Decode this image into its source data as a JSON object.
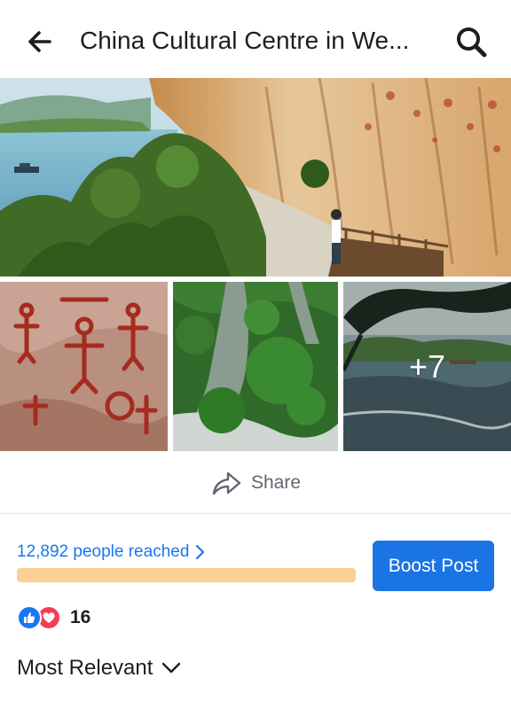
{
  "header": {
    "title": "China Cultural Centre in We...",
    "back_icon": "arrow-left-icon",
    "search_icon": "search-icon"
  },
  "post": {
    "more_photos": "+7",
    "share_label": "Share"
  },
  "insights": {
    "reach_text": "12,892 people reached",
    "reach_progress": 1.0,
    "bar_color": "#f9cf95",
    "boost_label": "Boost Post",
    "boost_color": "#1b74e4"
  },
  "reactions": {
    "types": [
      "like",
      "love"
    ],
    "count": "16"
  },
  "comments": {
    "sort_label": "Most Relevant"
  }
}
